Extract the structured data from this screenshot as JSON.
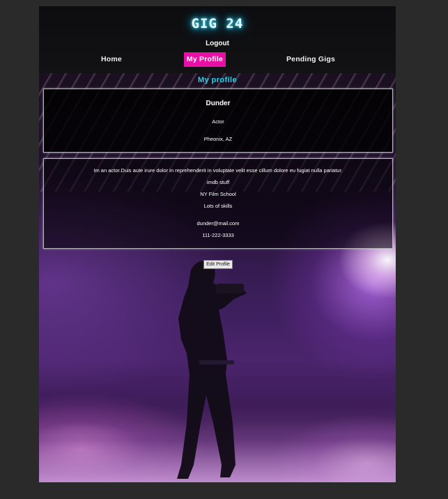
{
  "header": {
    "brand": "GIG 24",
    "logout_label": "Logout"
  },
  "nav": {
    "home": "Home",
    "profile": "My Profile",
    "pending": "Pending Gigs"
  },
  "main": {
    "section_title": "My profile",
    "profile": {
      "name": "Dunder",
      "role": "Actor",
      "location": "Pheonix, AZ"
    },
    "details": {
      "bio": "Im an actor.Duis aute irure dolor in reprehenderit in voluptate velit esse cillum dolore eu fugiat nulla pariatur.",
      "imdb": "imdb stuff",
      "school": "NY Film School",
      "skills": "Lots of skills",
      "email": "dunder@mail.com",
      "phone": "111-222-3333"
    },
    "edit_label": "Edit Profile"
  },
  "colors": {
    "accent": "#e80fa4",
    "title_cyan": "#26d6e8",
    "brand_glow": "#1fd0ff"
  }
}
